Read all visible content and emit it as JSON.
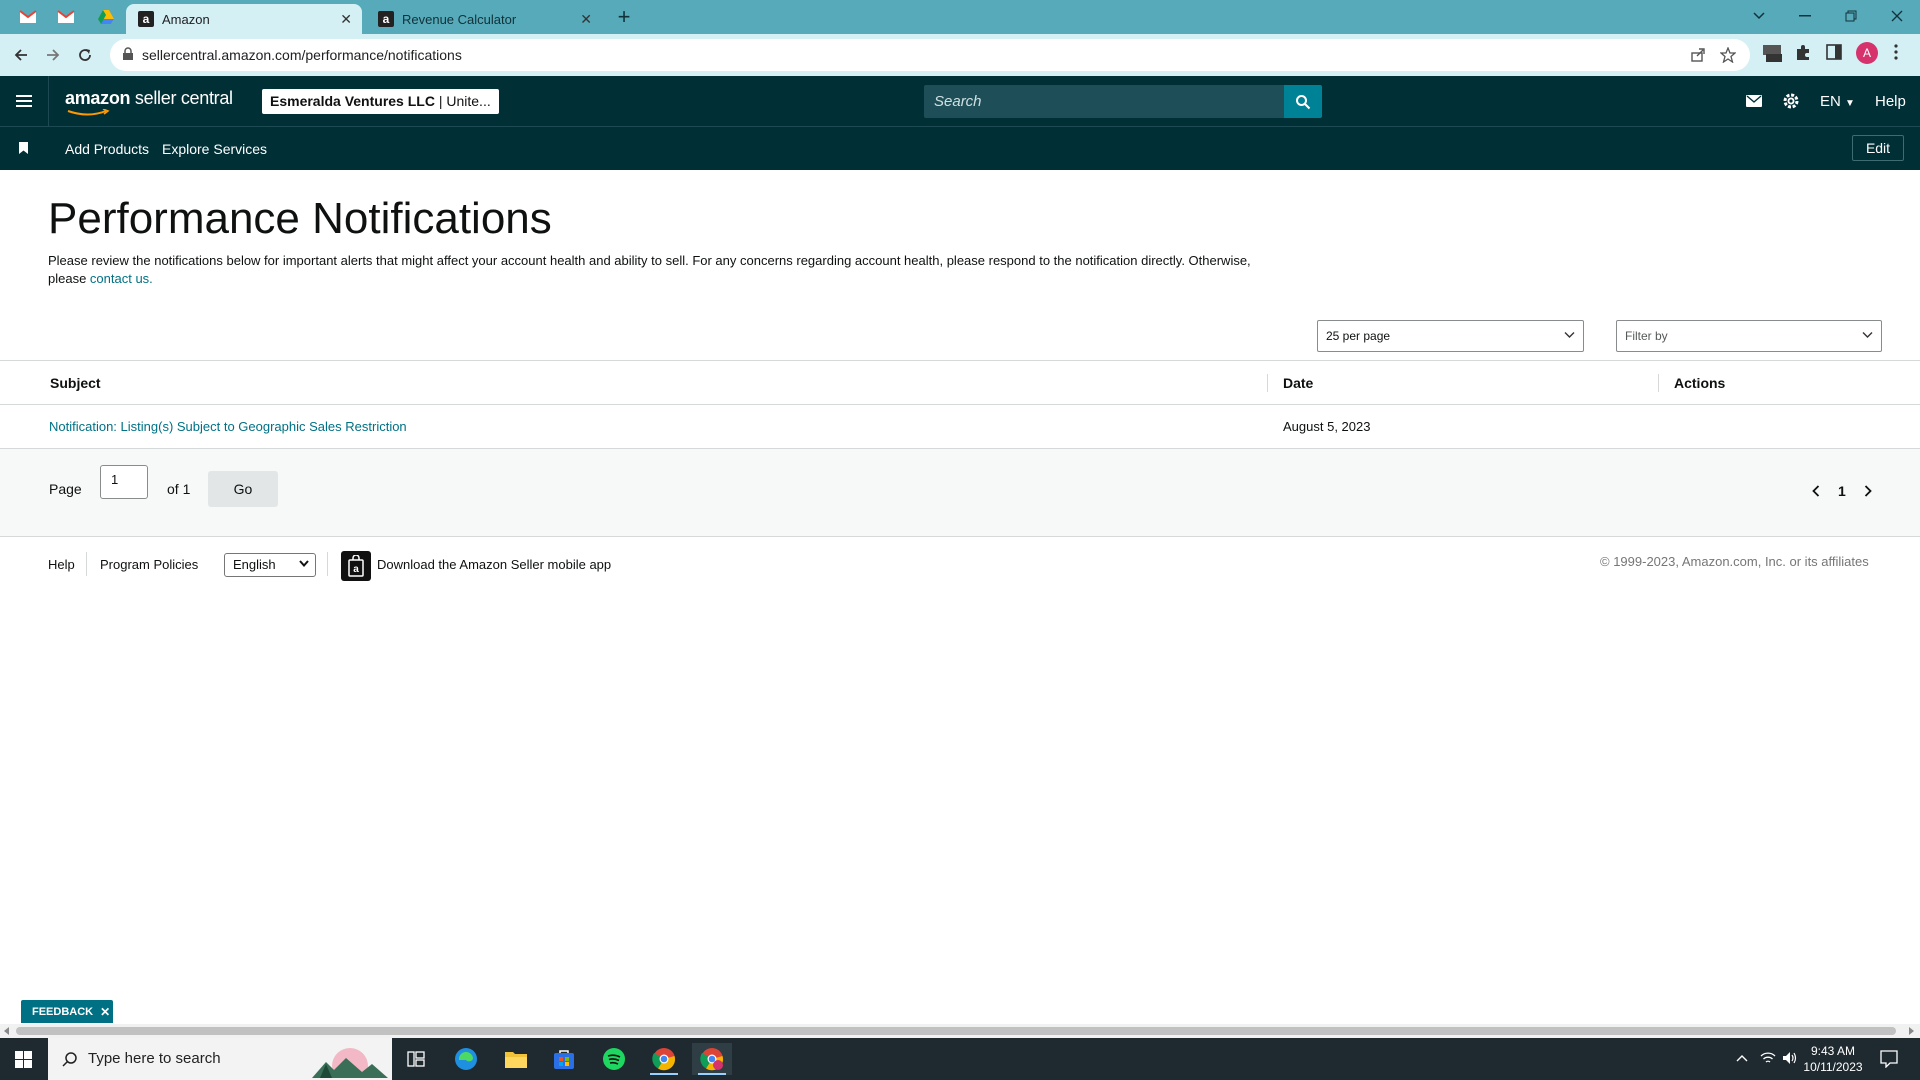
{
  "browser": {
    "tabs": [
      {
        "label": "Amazon",
        "favicon": "a",
        "active": true
      },
      {
        "label": "Revenue Calculator",
        "favicon": "a",
        "active": false
      }
    ],
    "url": "sellercentral.amazon.com/performance/notifications"
  },
  "header": {
    "logo_brand": "amazon",
    "logo_product": " seller central",
    "account_name": "Esmeralda Ventures LLC",
    "account_region": " | Unite...",
    "search_placeholder": "Search",
    "language": "EN",
    "help": "Help",
    "accent_color": "#002f36"
  },
  "subnav": {
    "links": [
      "Add Products",
      "Explore Services"
    ],
    "edit": "Edit"
  },
  "page": {
    "title": "Performance Notifications",
    "intro": "Please review the notifications below for important alerts that might affect your account health and ability to sell. For any concerns regarding account health, please respond to the notification directly. Otherwise, please ",
    "contact_link": "contact us.",
    "per_page": "25 per page",
    "filter_placeholder": "Filter by"
  },
  "table": {
    "columns": [
      "Subject",
      "Date",
      "Actions"
    ],
    "rows": [
      {
        "subject": "Notification: Listing(s) Subject to Geographic Sales Restriction",
        "date": "August 5, 2023",
        "actions": ""
      }
    ]
  },
  "pagination": {
    "page_label": "Page",
    "current": "1",
    "of_label": "of 1",
    "go": "Go",
    "page_number": "1"
  },
  "footer": {
    "help": "Help",
    "program_policies": "Program Policies",
    "language_select": "English",
    "app_link": "Download the Amazon Seller mobile app",
    "copyright": "© 1999-2023, Amazon.com, Inc. or its affiliates"
  },
  "feedback": "FEEDBACK",
  "taskbar": {
    "search_placeholder": "Type here to search",
    "time": "9:43 AM",
    "date": "10/11/2023"
  }
}
